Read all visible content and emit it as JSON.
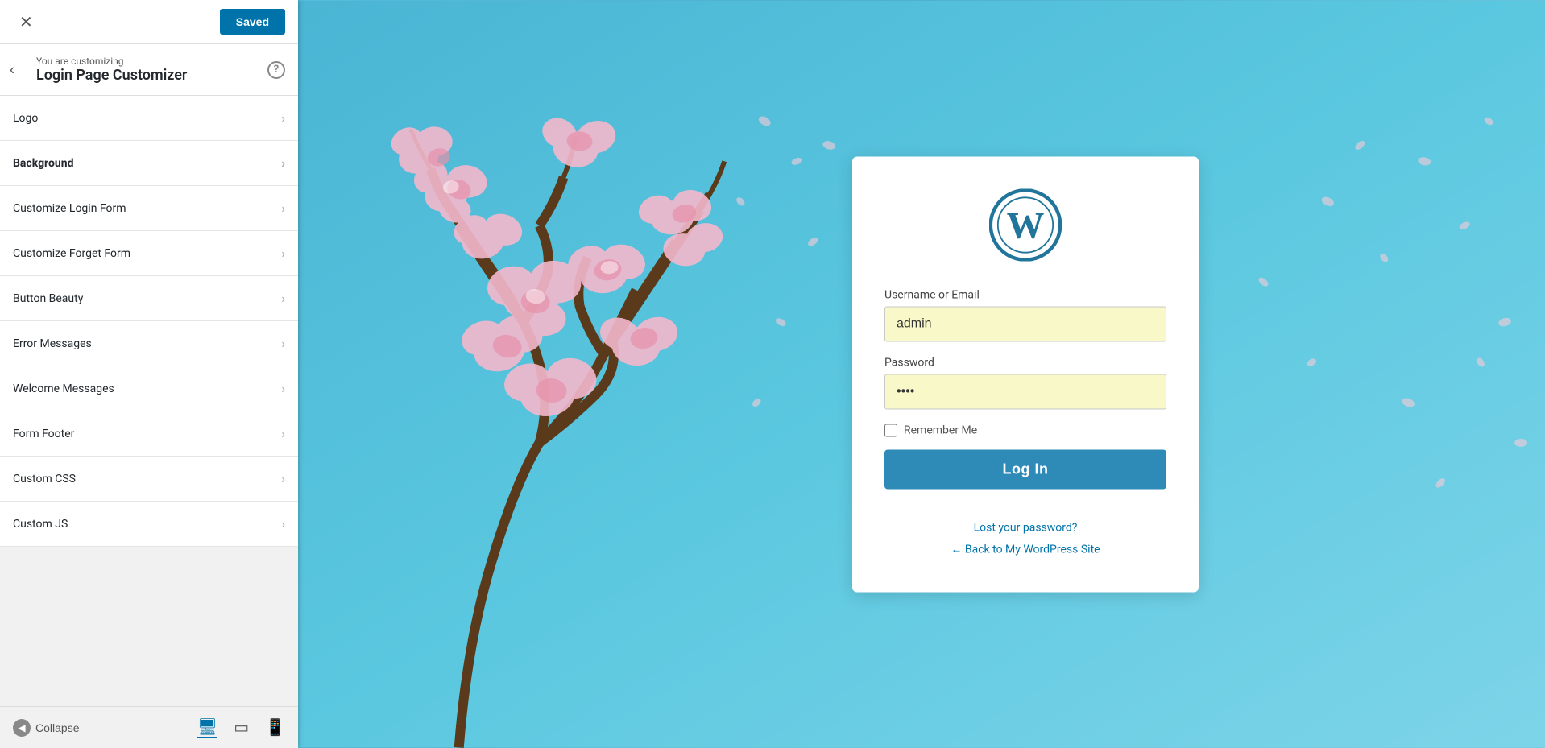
{
  "panel": {
    "close_label": "✕",
    "saved_label": "Saved",
    "back_label": "‹",
    "customizing_text": "You are customizing",
    "page_title": "Login Page Customizer",
    "help_label": "?",
    "menu_items": [
      {
        "id": "logo",
        "label": "Logo",
        "active": false
      },
      {
        "id": "background",
        "label": "Background",
        "active": true
      },
      {
        "id": "customize-login-form",
        "label": "Customize Login Form",
        "active": false
      },
      {
        "id": "customize-forget-form",
        "label": "Customize Forget Form",
        "active": false
      },
      {
        "id": "button-beauty",
        "label": "Button Beauty",
        "active": false
      },
      {
        "id": "error-messages",
        "label": "Error Messages",
        "active": false
      },
      {
        "id": "welcome-messages",
        "label": "Welcome Messages",
        "active": false
      },
      {
        "id": "form-footer",
        "label": "Form Footer",
        "active": false
      },
      {
        "id": "custom-css",
        "label": "Custom CSS",
        "active": false
      },
      {
        "id": "custom-js",
        "label": "Custom JS",
        "active": false
      }
    ],
    "collapse_label": "Collapse",
    "devices": [
      {
        "id": "desktop",
        "icon": "🖥",
        "active": true
      },
      {
        "id": "tablet",
        "icon": "📋",
        "active": false
      },
      {
        "id": "mobile",
        "icon": "📱",
        "active": false
      }
    ]
  },
  "login_form": {
    "username_label": "Username or Email",
    "username_value": "admin",
    "password_label": "Password",
    "password_placeholder": "••••",
    "remember_label": "Remember Me",
    "login_button": "Log In",
    "lost_password": "Lost your password?",
    "back_to_site": "← Back to My WordPress Site"
  }
}
